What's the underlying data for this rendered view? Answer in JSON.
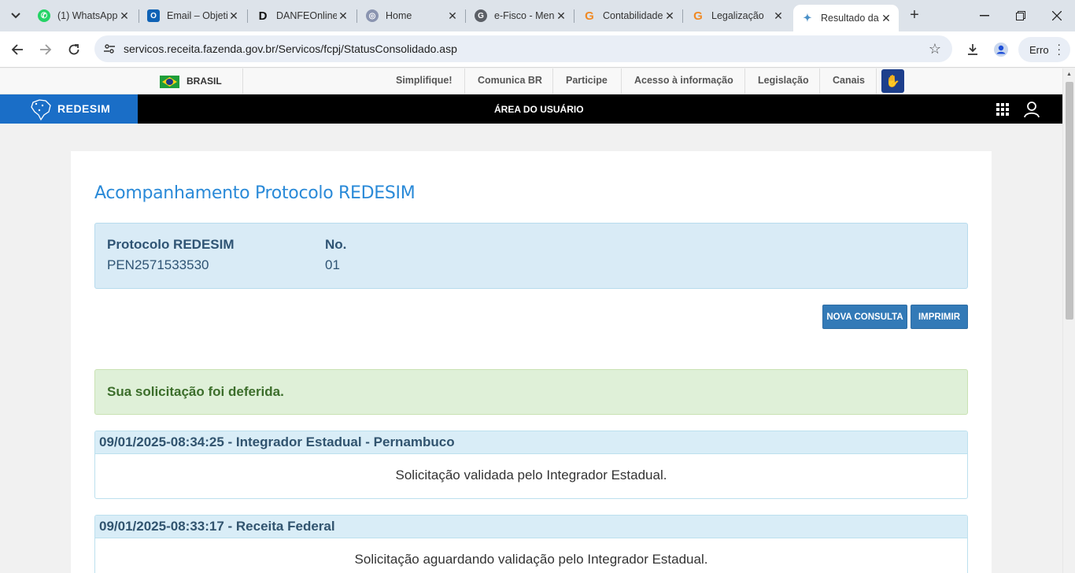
{
  "browser": {
    "tabs": [
      {
        "title": "(1) WhatsApp",
        "favicon": "whatsapp-icon"
      },
      {
        "title": "Email – Objetivo",
        "favicon": "outlook-icon"
      },
      {
        "title": "DANFEOnline",
        "favicon": "danfe-icon"
      },
      {
        "title": "Home",
        "favicon": "badge-icon"
      },
      {
        "title": "e-Fisco - Menu",
        "favicon": "google-g-icon"
      },
      {
        "title": "Contabilidade",
        "favicon": "g-orange-icon"
      },
      {
        "title": "Legalização",
        "favicon": "g-orange-icon"
      },
      {
        "title": "Resultado da",
        "favicon": "redesim-icon"
      }
    ],
    "url": "servicos.receita.fazenda.gov.br/Servicos/fcpj/StatusConsolidado.asp",
    "profile_button": "Erro"
  },
  "govbar": {
    "country": "BRASIL",
    "links": [
      "Simplifique!",
      "Comunica BR",
      "Participe",
      "Acesso à informação",
      "Legislação",
      "Canais"
    ]
  },
  "header": {
    "logo": "REDESIM",
    "area_label": "ÁREA DO USUÁRIO"
  },
  "main": {
    "title": "Acompanhamento Protocolo REDESIM",
    "protocol_label": "Protocolo REDESIM",
    "protocol_value": "PEN2571533530",
    "number_label": "No.",
    "number_value": "01",
    "new_query_button": "NOVA CONSULTA",
    "print_button": "IMPRIMIR",
    "status_message": "Sua solicitação foi deferida.",
    "events": [
      {
        "header": "09/01/2025-08:34:25 - Integrador Estadual - Pernambuco",
        "body": "Solicitação validada pelo Integrador Estadual."
      },
      {
        "header": "09/01/2025-08:33:17 - Receita Federal",
        "body": "Solicitação aguardando validação pelo Integrador Estadual."
      }
    ]
  },
  "colors": {
    "title_blue": "#2a8ad8",
    "button_blue": "#337ab7",
    "success_bg": "#dff0d8",
    "info_bg": "#d9edf7",
    "redesim_blue": "#1a6ec7"
  }
}
